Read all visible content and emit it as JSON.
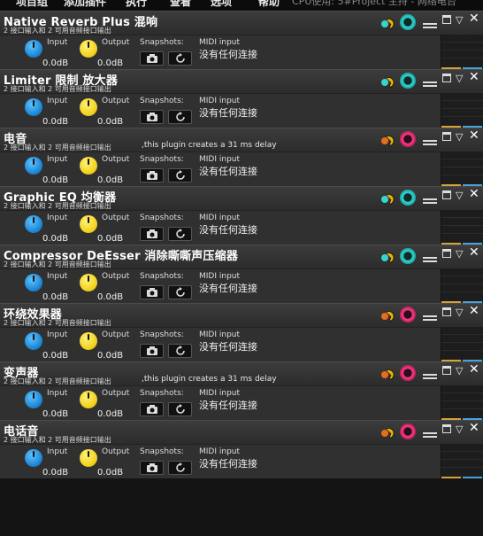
{
  "menu": {
    "items": [
      "项目组",
      "添加插件",
      "执行",
      "查看",
      "选项",
      "帮助"
    ],
    "status": "CPU使用: 5#Project 主持 - 网络电台"
  },
  "common": {
    "input_label": "Input",
    "output_label": "Output",
    "input_value": "0.0dB",
    "output_value": "0.0dB",
    "snapshots_label": "Snapshots:",
    "midi_label": "MIDI input",
    "midi_value": "没有任何连接"
  },
  "colors": {
    "power_on": "#35d6d0",
    "power_off": "#ff3d8a",
    "input_knob": "#1b86d4",
    "output_knob": "#f2d21c"
  },
  "plugins": [
    {
      "name": "Native Reverb Plus 混响",
      "io": "2 接口输入和 2 可用音频接口输出",
      "delay": "",
      "state": "on"
    },
    {
      "name": "Limiter 限制 放大器",
      "io": "2 接口输入和 2 可用音频接口输出",
      "delay": "",
      "state": "on"
    },
    {
      "name": "电音",
      "io": "2 接口输入和 2 可用音频接口输出",
      "delay": ",this plugin creates a 31 ms delay",
      "state": "off"
    },
    {
      "name": "Graphic EQ 均衡器",
      "io": "2 接口输入和 2 可用音频接口输出",
      "delay": "",
      "state": "on"
    },
    {
      "name": "Compressor DeEsser 消除嘶嘶声压缩器",
      "io": "2 接口输入和 2 可用音频接口输出",
      "delay": "",
      "state": "on"
    },
    {
      "name": "环绕效果器",
      "io": "2 接口输入和 2 可用音频接口输出",
      "delay": "",
      "state": "off"
    },
    {
      "name": "变声器",
      "io": "2 接口输入和 2 可用音频接口输出",
      "delay": ",this plugin creates a 31 ms delay",
      "state": "off"
    },
    {
      "name": "电话音",
      "io": "2 接口输入和 2 可用音频接口输出",
      "delay": "",
      "state": "off"
    }
  ]
}
